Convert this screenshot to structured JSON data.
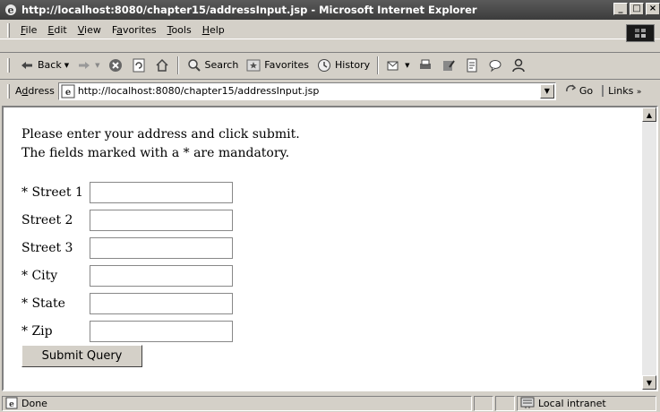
{
  "window": {
    "title": "http://localhost:8080/chapter15/addressInput.jsp - Microsoft Internet Explorer",
    "controls": {
      "minimize": "_",
      "maximize": "□",
      "close": "×"
    }
  },
  "menubar": {
    "items": [
      {
        "label": "File",
        "underline": "F",
        "rest": "ile"
      },
      {
        "label": "Edit",
        "underline": "E",
        "rest": "dit"
      },
      {
        "label": "View",
        "underline": "V",
        "rest": "iew"
      },
      {
        "label": "Favorites",
        "underline": "a",
        "pre": "F",
        "rest": "vorites"
      },
      {
        "label": "Tools",
        "underline": "T",
        "rest": "ools"
      },
      {
        "label": "Help",
        "underline": "H",
        "rest": "elp"
      }
    ]
  },
  "toolbar": {
    "back_label": "Back",
    "search_label": "Search",
    "favorites_label": "Favorites",
    "history_label": "History"
  },
  "addressbar": {
    "label": "Address",
    "label_underline": "d",
    "url": "http://localhost:8080/chapter15/addressInput.jsp",
    "go_label": "Go",
    "links_label": "Links"
  },
  "page": {
    "intro_line1": "Please enter your address and click submit.",
    "intro_line2": "The fields marked with a * are mandatory.",
    "fields": [
      {
        "label": "* Street 1",
        "value": ""
      },
      {
        "label": "Street 2",
        "value": ""
      },
      {
        "label": "Street 3",
        "value": ""
      },
      {
        "label": "* City",
        "value": ""
      },
      {
        "label": "* State",
        "value": ""
      },
      {
        "label": "* Zip",
        "value": ""
      }
    ],
    "submit_label": "Submit Query"
  },
  "statusbar": {
    "status": "Done",
    "zone": "Local intranet"
  },
  "colors": {
    "titlebar": "#4a4a4a",
    "chrome": "#d4d0c8",
    "content": "#ffffff"
  }
}
